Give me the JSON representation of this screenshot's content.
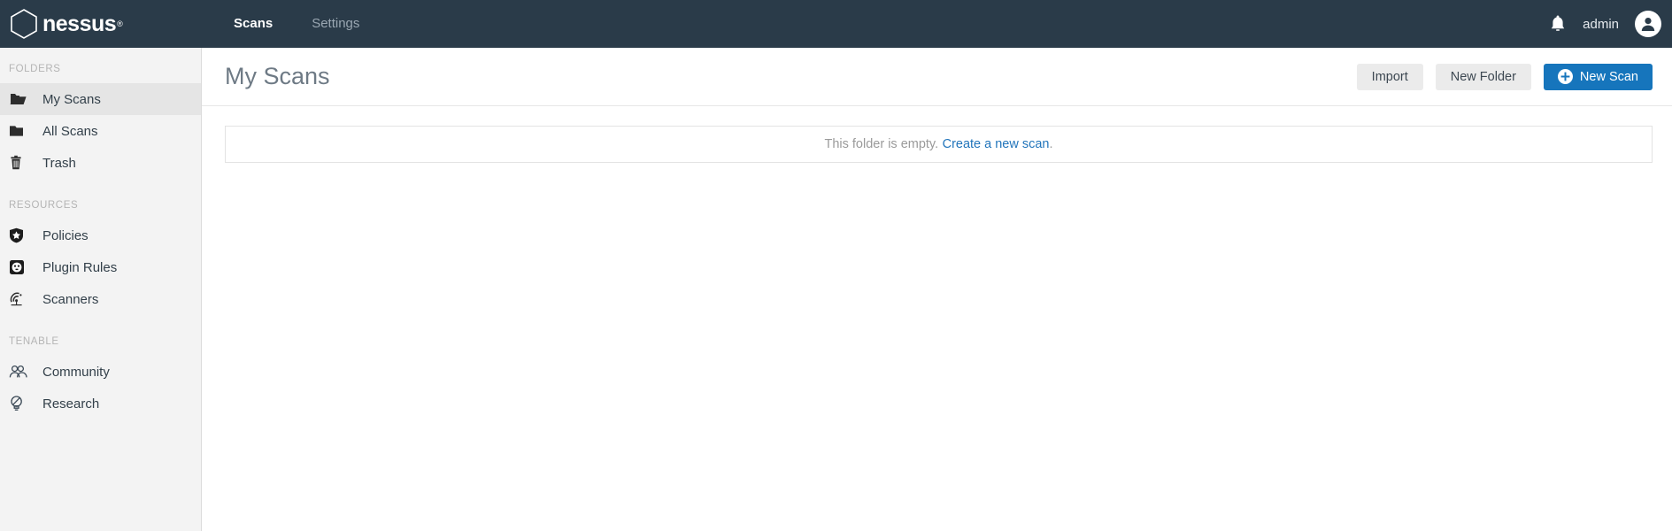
{
  "brand": {
    "name": "nessus",
    "trademark": "®",
    "logo_icon": "hexagon-icon"
  },
  "topnav": {
    "links": [
      {
        "label": "Scans",
        "active": true
      },
      {
        "label": "Settings",
        "active": false
      }
    ],
    "notifications_icon": "bell-icon",
    "username": "admin",
    "avatar_icon": "user-avatar-icon",
    "background_color": "#2a3b49"
  },
  "sidebar": {
    "sections": [
      {
        "heading": "FOLDERS",
        "items": [
          {
            "label": "My Scans",
            "icon": "folder-open-icon",
            "active": true
          },
          {
            "label": "All Scans",
            "icon": "folder-icon",
            "active": false
          },
          {
            "label": "Trash",
            "icon": "trash-icon",
            "active": false
          }
        ]
      },
      {
        "heading": "RESOURCES",
        "items": [
          {
            "label": "Policies",
            "icon": "shield-star-icon",
            "active": false
          },
          {
            "label": "Plugin Rules",
            "icon": "power-outlet-icon",
            "active": false
          },
          {
            "label": "Scanners",
            "icon": "radar-icon",
            "active": false
          }
        ]
      },
      {
        "heading": "TENABLE",
        "items": [
          {
            "label": "Community",
            "icon": "people-icon",
            "active": false
          },
          {
            "label": "Research",
            "icon": "lightbulb-icon",
            "active": false
          }
        ]
      }
    ]
  },
  "main": {
    "title": "My Scans",
    "buttons": {
      "import": "Import",
      "new_folder": "New Folder",
      "new_scan": "New Scan",
      "new_scan_icon": "plus-circle-icon",
      "primary_color": "#1675bc"
    },
    "empty_state": {
      "message": "This folder is empty.",
      "link_text": "Create a new scan",
      "link_suffix": ".",
      "link_color": "#2275bb"
    }
  }
}
